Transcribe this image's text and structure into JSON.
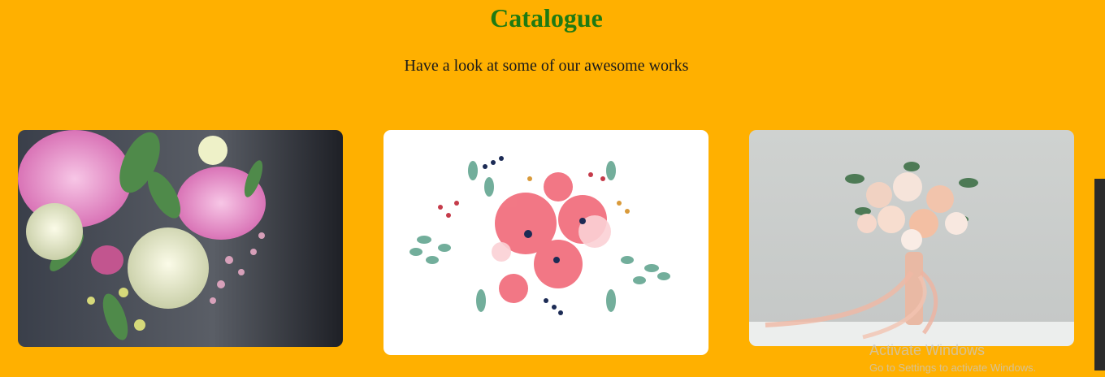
{
  "page": {
    "title": "Catalogue",
    "subtitle": "Have a look at some of our awesome works"
  },
  "gallery": {
    "items": [
      {
        "name": "flower-bouquet-photo-1"
      },
      {
        "name": "watercolor-poppy-bouquet"
      },
      {
        "name": "bridal-bouquet-photo"
      }
    ]
  },
  "os_overlay": {
    "activate_title": "Activate Windows",
    "activate_hint": "Go to Settings to activate Windows."
  },
  "colors": {
    "background": "#FFB000",
    "title": "#1f7a12",
    "text": "#1a1a1a"
  }
}
